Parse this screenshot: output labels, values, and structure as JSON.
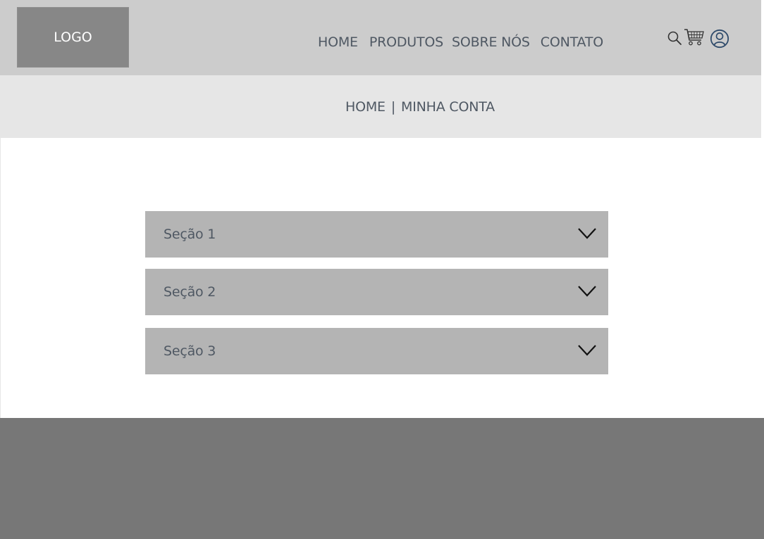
{
  "header": {
    "logo_label": "LOGO",
    "nav": [
      {
        "label": "HOME"
      },
      {
        "label": "PRODUTOS"
      },
      {
        "label": "SOBRE NÓS"
      },
      {
        "label": "CONTATO"
      }
    ],
    "icons": [
      "search-icon",
      "cart-icon",
      "user-icon"
    ]
  },
  "breadcrumb": {
    "home": "HOME",
    "separator": "|",
    "current": "MINHA CONTA"
  },
  "accordion": {
    "sections": [
      {
        "label": "Seção 1",
        "icon": "chevron-down-icon"
      },
      {
        "label": "Seção 2",
        "icon": "chevron-down-icon"
      },
      {
        "label": "Seção 3",
        "icon": "chevron-down-icon"
      }
    ]
  },
  "colors": {
    "header_bg": "#cccccc",
    "logo_bg": "#878787",
    "breadcrumb_bg": "#e6e6e6",
    "accordion_bg": "#b4b4b4",
    "footer_bg": "#777777",
    "text": "#4f5863",
    "user_icon": "#2e4a6a"
  }
}
